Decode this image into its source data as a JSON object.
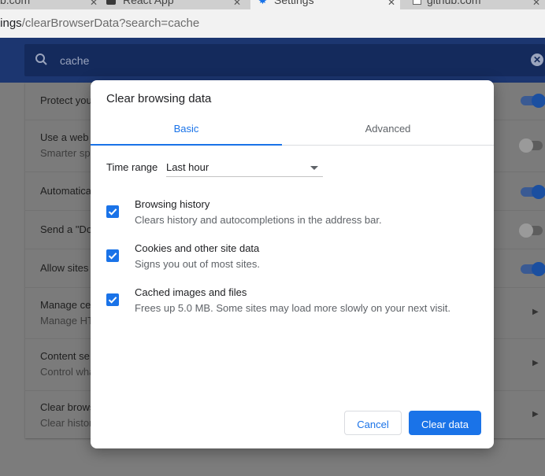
{
  "tabs": [
    {
      "label": "b.com",
      "close": "✕"
    },
    {
      "label": "React App",
      "close": "✕"
    },
    {
      "label": "Settings",
      "close": "✕"
    },
    {
      "label": "github.com",
      "close": "✕"
    }
  ],
  "address_bar": {
    "host_fragment": "tings",
    "path": "/clearBrowserData?search=cache"
  },
  "search": {
    "query": "cache",
    "clear_icon": "✕"
  },
  "settings_rows": [
    {
      "title": "Protect you",
      "subtitle": "",
      "control": "toggle",
      "state": "on"
    },
    {
      "title": "Use a web s",
      "subtitle": "Smarter sp",
      "control": "toggle",
      "state": "off"
    },
    {
      "title": "Automatica",
      "subtitle": "",
      "control": "toggle",
      "state": "on"
    },
    {
      "title": "Send a \"Do",
      "subtitle": "",
      "control": "toggle",
      "state": "off"
    },
    {
      "title": "Allow sites",
      "subtitle": "",
      "control": "toggle",
      "state": "on"
    },
    {
      "title": "Manage ce",
      "subtitle": "Manage HT",
      "control": "arrow"
    },
    {
      "title": "Content se",
      "subtitle": "Control wha",
      "control": "arrow"
    },
    {
      "title": "Clear brows",
      "subtitle": "Clear histor",
      "control": "arrow"
    }
  ],
  "dialog": {
    "title": "Clear browsing data",
    "tabs": {
      "basic": "Basic",
      "advanced": "Advanced",
      "active": "basic"
    },
    "time_range": {
      "label": "Time range",
      "value": "Last hour"
    },
    "options": [
      {
        "title": "Browsing history",
        "description": "Clears history and autocompletions in the address bar.",
        "checked": true
      },
      {
        "title": "Cookies and other site data",
        "description": "Signs you out of most sites.",
        "checked": true
      },
      {
        "title": "Cached images and files",
        "description": "Frees up 5.0 MB. Some sites may load more slowly on your next visit.",
        "checked": true
      }
    ],
    "buttons": {
      "cancel": "Cancel",
      "confirm": "Clear data"
    }
  },
  "colors": {
    "accent": "#1a73e8",
    "header": "#1c3670",
    "overlay_page": "#7b7b7b"
  }
}
